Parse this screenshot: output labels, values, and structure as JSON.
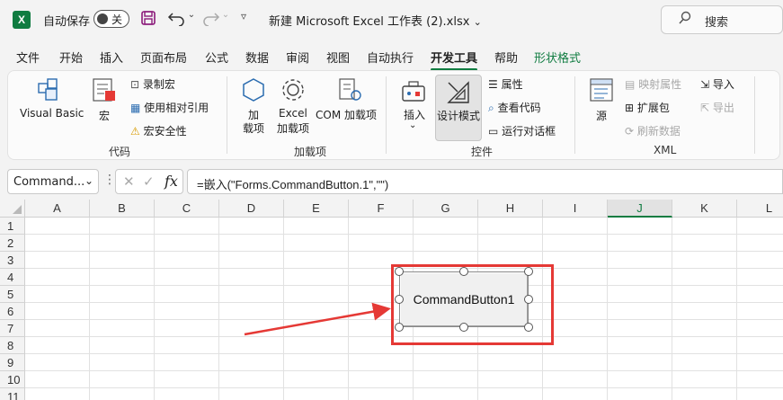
{
  "titlebar": {
    "logo": "X",
    "autosave_label": "自动保存",
    "autosave_state": "关",
    "file_name": "新建 Microsoft Excel 工作表 (2).xlsx",
    "search_placeholder": "搜索",
    "icons": [
      "excel-logo-icon",
      "save-icon",
      "undo-icon",
      "redo-icon",
      "customize-qat-icon",
      "search-icon"
    ]
  },
  "tabs": [
    {
      "label": "文件"
    },
    {
      "label": "开始"
    },
    {
      "label": "插入"
    },
    {
      "label": "页面布局"
    },
    {
      "label": "公式"
    },
    {
      "label": "数据"
    },
    {
      "label": "审阅"
    },
    {
      "label": "视图"
    },
    {
      "label": "自动执行"
    },
    {
      "label": "开发工具",
      "active": true
    },
    {
      "label": "帮助"
    },
    {
      "label": "形状格式",
      "contextual": true
    }
  ],
  "ribbon": {
    "code": {
      "label": "代码",
      "visual_basic": "Visual Basic",
      "macros": "宏",
      "record_macro": "录制宏",
      "relative_refs": "使用相对引用",
      "macro_security": "宏安全性"
    },
    "addins": {
      "label": "加载项",
      "addins_l1": "加",
      "addins_l2": "载项",
      "excel_addins_l1": "Excel",
      "excel_addins_l2": "加载项",
      "com_addins": "COM 加载项"
    },
    "controls": {
      "label": "控件",
      "insert": "插入",
      "design_mode": "设计模式",
      "properties": "属性",
      "view_code": "查看代码",
      "run_dialog": "运行对话框"
    },
    "xml": {
      "label": "XML",
      "source": "源",
      "map_properties": "映射属性",
      "expansion_packs": "扩展包",
      "refresh_data": "刷新数据",
      "import": "导入",
      "export": "导出"
    }
  },
  "formula_bar": {
    "name_box": "Command...",
    "fx": "fx",
    "formula": "=嵌入(\"Forms.CommandButton.1\",\"\")"
  },
  "sheet": {
    "columns": [
      "A",
      "B",
      "C",
      "D",
      "E",
      "F",
      "G",
      "H",
      "I",
      "J",
      "K",
      "L"
    ],
    "selected_column": "J",
    "rows": [
      "1",
      "2",
      "3",
      "4",
      "5",
      "6",
      "7",
      "8",
      "9",
      "10",
      "11"
    ],
    "command_button_caption": "CommandButton1"
  },
  "colors": {
    "accent": "#107c41",
    "highlight_box": "#e53935",
    "arrow": "#e53935"
  }
}
